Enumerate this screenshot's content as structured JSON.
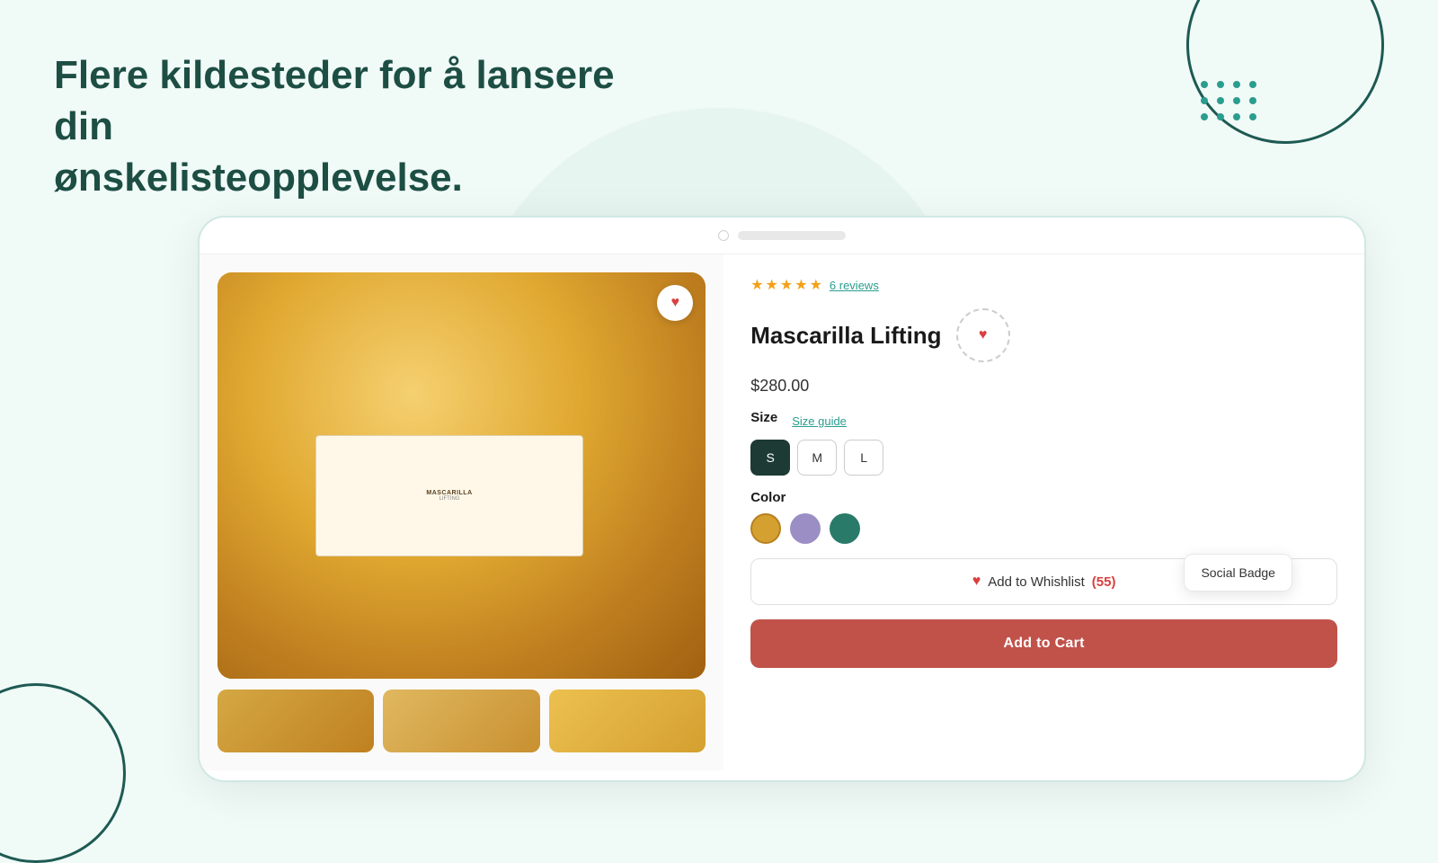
{
  "page": {
    "background_color": "#f0faf7"
  },
  "headline": {
    "line1": "Flere kildesteder for å lansere din",
    "line2": "ønskelisteopplevelse."
  },
  "product": {
    "title": "Mascarilla Lifting",
    "price": "$280.00",
    "rating": 5,
    "reviews_text": "6 reviews",
    "size_label": "Size",
    "size_guide_label": "Size guide",
    "sizes": [
      "S",
      "M",
      "L"
    ],
    "selected_size": "S",
    "color_label": "Color",
    "colors": [
      "gold",
      "purple",
      "teal"
    ],
    "wishlist_btn_label": "Add to Whishlist",
    "wishlist_count": "(55)",
    "add_to_cart_label": "Add to Cart",
    "social_badge_label": "Social Badge",
    "jar_label_line1": "MASCARILLA",
    "jar_label_line2": "LIFTING"
  },
  "icons": {
    "heart_filled": "♥",
    "star": "★"
  }
}
